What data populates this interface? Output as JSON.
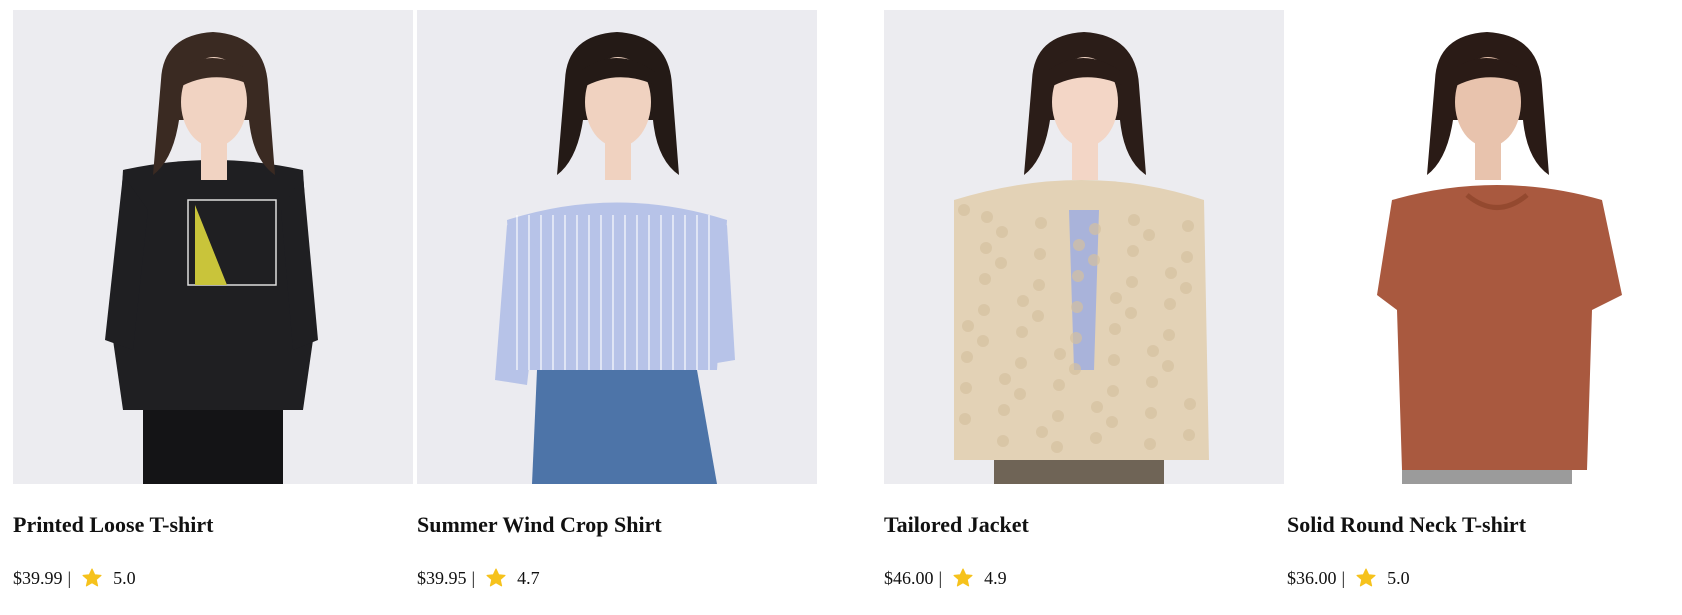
{
  "products": [
    {
      "name": "Printed Loose T-shirt",
      "price": "$39.99",
      "separator": "|",
      "rating": "5.0",
      "image_description_icon": "model-photo-black-sweatshirt",
      "colors": {
        "background": "#ececf0",
        "garment": "#1f1f22",
        "accent": "#c9c43a",
        "hair": "#3a2a22",
        "skin": "#f1d3c2",
        "lower": "#141416"
      }
    },
    {
      "name": "Summer Wind Crop Shirt",
      "price": "$39.95",
      "separator": "|",
      "rating": "4.7",
      "image_description_icon": "model-photo-striped-blue-shirt",
      "colors": {
        "background": "#ebebf0",
        "garment": "#b7c3e8",
        "accent": "#ffffff",
        "hair": "#241a16",
        "skin": "#f0d2c0",
        "lower": "#4d74a8"
      }
    },
    {
      "name": "Tailored Jacket",
      "price": "$46.00",
      "separator": "|",
      "rating": "4.9",
      "image_description_icon": "model-photo-sherpa-jacket",
      "colors": {
        "background": "#ececf0",
        "garment": "#e3d2b6",
        "accent": "#a9b3da",
        "hair": "#2b1d18",
        "skin": "#f3d6c6",
        "lower": "#6f6456"
      }
    },
    {
      "name": "Solid Round Neck T-shirt",
      "price": "$36.00",
      "separator": "|",
      "rating": "5.0",
      "image_description_icon": "model-photo-brown-tshirt",
      "colors": {
        "background": "#ffffff",
        "garment": "#a9593f",
        "accent": "#94492f",
        "hair": "#2a1b16",
        "skin": "#e8c3ad",
        "lower": "#9b9b9b"
      }
    }
  ],
  "star_color": "#f6c21c"
}
